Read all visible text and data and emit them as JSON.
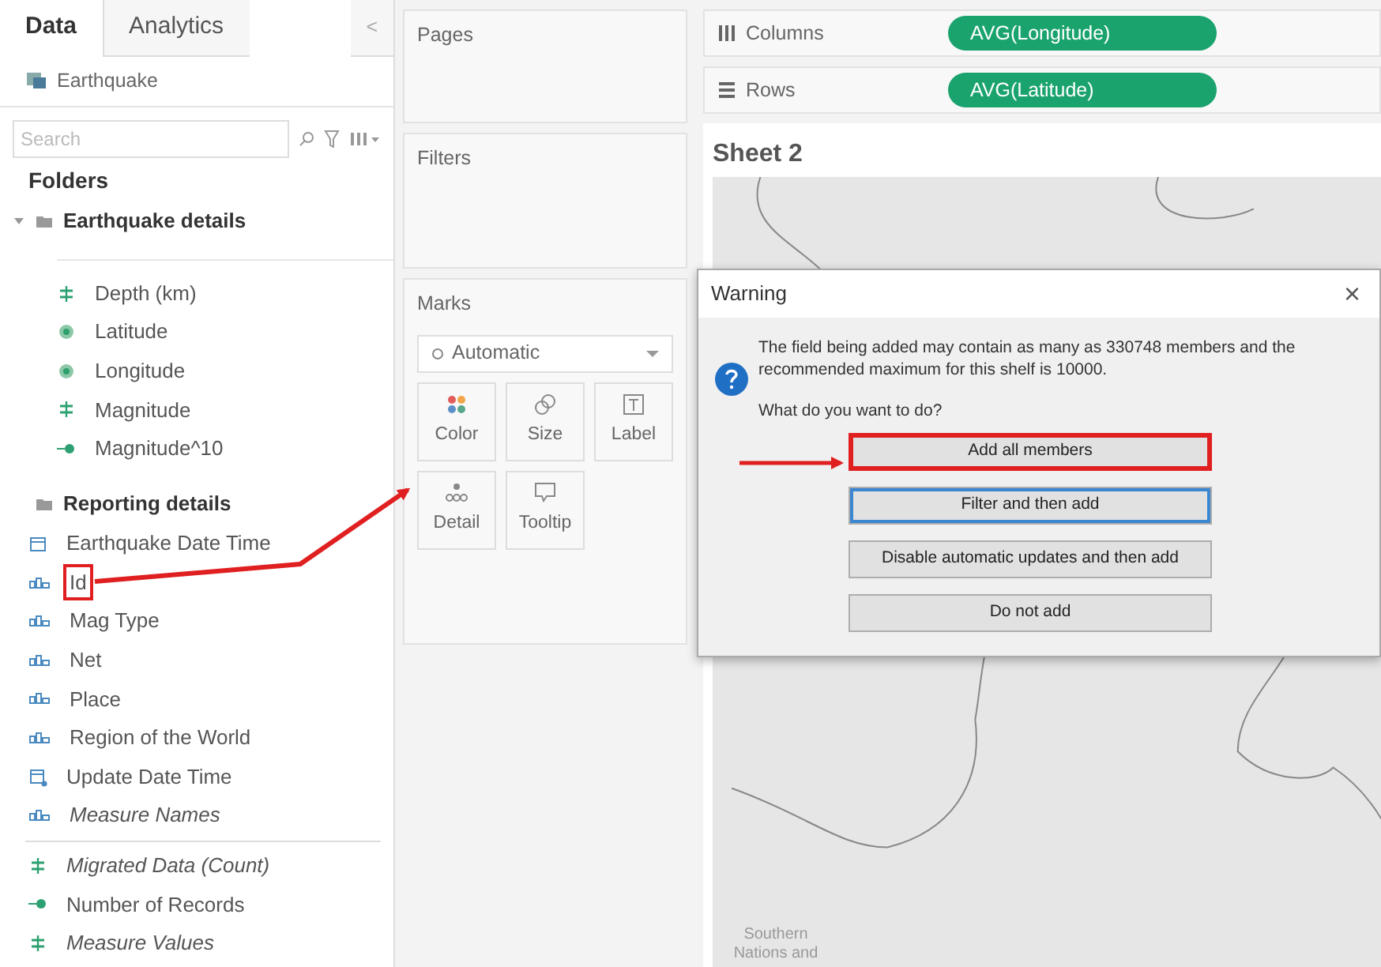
{
  "data_pane": {
    "tabs": [
      {
        "label": "Data",
        "selected": true
      },
      {
        "label": "Analytics",
        "selected": false
      }
    ],
    "collapse_glyph": "<",
    "datasource": "Earthquake",
    "search": {
      "placeholder": "Search"
    },
    "folders_heading": "Folders",
    "folders": [
      {
        "label": "Earthquake details",
        "expanded": true,
        "children": [
          {
            "label": "Depth (km)",
            "kind": "measure",
            "italic": false,
            "highlighted": false
          },
          {
            "label": "Latitude",
            "kind": "geo",
            "italic": false,
            "highlighted": false
          },
          {
            "label": "Longitude",
            "kind": "geo",
            "italic": false,
            "highlighted": false
          },
          {
            "label": "Magnitude",
            "kind": "measure",
            "italic": false,
            "highlighted": false
          },
          {
            "label": "Magnitude^10",
            "kind": "calc",
            "italic": false,
            "highlighted": false
          }
        ]
      },
      {
        "label": "Reporting details",
        "expanded": true,
        "children": [
          {
            "label": "Earthquake Date Time",
            "kind": "date",
            "italic": false,
            "highlighted": false
          },
          {
            "label": "Id",
            "kind": "string",
            "italic": false,
            "highlighted": true
          },
          {
            "label": "Mag Type",
            "kind": "string",
            "italic": false,
            "highlighted": false
          },
          {
            "label": "Net",
            "kind": "string",
            "italic": false,
            "highlighted": false
          },
          {
            "label": "Place",
            "kind": "string",
            "italic": false,
            "highlighted": false
          },
          {
            "label": "Region of the World",
            "kind": "string",
            "italic": false,
            "highlighted": false
          },
          {
            "label": "Update Date Time",
            "kind": "datetime",
            "italic": false,
            "highlighted": false
          },
          {
            "label": "Measure Names",
            "kind": "string",
            "italic": true,
            "highlighted": false
          }
        ]
      }
    ],
    "measures": [
      {
        "label": "Migrated Data (Count)",
        "kind": "measure",
        "italic": true,
        "highlighted": false
      },
      {
        "label": "Number of Records",
        "kind": "calc",
        "italic": false,
        "highlighted": false
      },
      {
        "label": "Measure Values",
        "kind": "measure",
        "italic": true,
        "highlighted": false
      }
    ]
  },
  "shelves": {
    "pages": "Pages",
    "filters": "Filters",
    "columns": {
      "label": "Columns",
      "pill": "AVG(Longitude)"
    },
    "rows": {
      "label": "Rows",
      "pill": "AVG(Latitude)"
    }
  },
  "marks": {
    "title": "Marks",
    "mark_type": "Automatic",
    "cards": [
      {
        "label": "Color",
        "kind": "color"
      },
      {
        "label": "Size",
        "kind": "size"
      },
      {
        "label": "Label",
        "kind": "label"
      },
      {
        "label": "Detail",
        "kind": "detail"
      },
      {
        "label": "Tooltip",
        "kind": "tooltip"
      }
    ]
  },
  "sheet": {
    "title": "Sheet 2",
    "map_label": "Southern Nations and"
  },
  "dialog": {
    "title": "Warning",
    "close_glyph": "×",
    "message": "The field being added may contain as many as 330748 members and the recommended maximum for this shelf is 10000.",
    "question": "What do you want to do?",
    "buttons": [
      {
        "label": "Add all members",
        "highlighted": true,
        "focused": false
      },
      {
        "label": "Filter and then add",
        "highlighted": false,
        "focused": true
      },
      {
        "label": "Disable automatic updates and then add",
        "highlighted": false,
        "focused": false
      },
      {
        "label": "Do not add",
        "highlighted": false,
        "focused": false
      }
    ]
  }
}
